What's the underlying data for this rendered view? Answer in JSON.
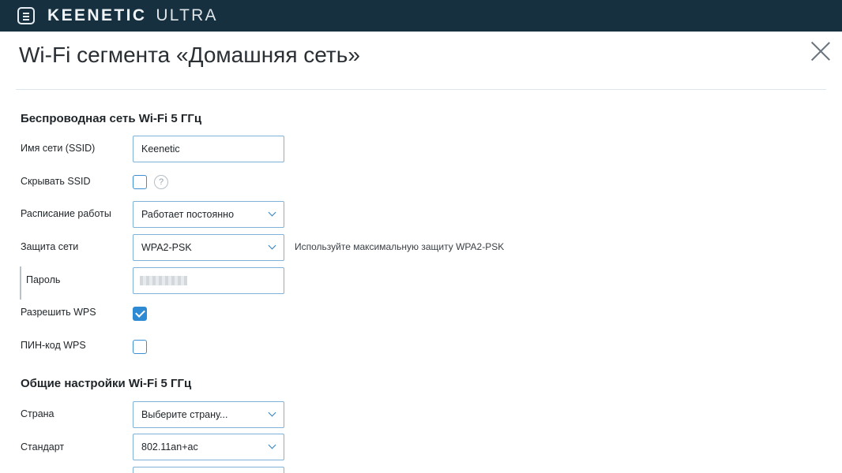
{
  "header": {
    "brand_main": "KEENETIC",
    "brand_sub": "ULTRA"
  },
  "page": {
    "title": "Wi-Fi сегмента «Домашняя сеть»"
  },
  "wireless": {
    "section_title": "Беспроводная сеть Wi-Fi 5 ГГц",
    "ssid_label": "Имя сети (SSID)",
    "ssid_value": "Keenetic",
    "hide_ssid_label": "Скрывать SSID",
    "hide_ssid_checked": false,
    "help_glyph": "?",
    "schedule_label": "Расписание работы",
    "schedule_value": "Работает постоянно",
    "security_label": "Защита сети",
    "security_value": "WPA2-PSK",
    "security_hint": "Используйте максимальную защиту WPA2-PSK",
    "password_label": "Пароль",
    "wps_label": "Разрешить WPS",
    "wps_checked": true,
    "wps_pin_label": "ПИН-код WPS",
    "wps_pin_checked": false
  },
  "general": {
    "section_title": "Общие настройки Wi-Fi 5 ГГц",
    "country_label": "Страна",
    "country_value": "Выберите страну...",
    "standard_label": "Стандарт",
    "standard_value": "802.11an+ac"
  },
  "icons": {
    "menu": "menu-icon",
    "close": "close-icon",
    "help": "question-circle-icon",
    "select_arrow": "chevron-down-icon",
    "check": "check-icon"
  },
  "colors": {
    "topbar": "#16303f",
    "accent": "#2e8ad3",
    "field_border": "#7fb2d6"
  }
}
